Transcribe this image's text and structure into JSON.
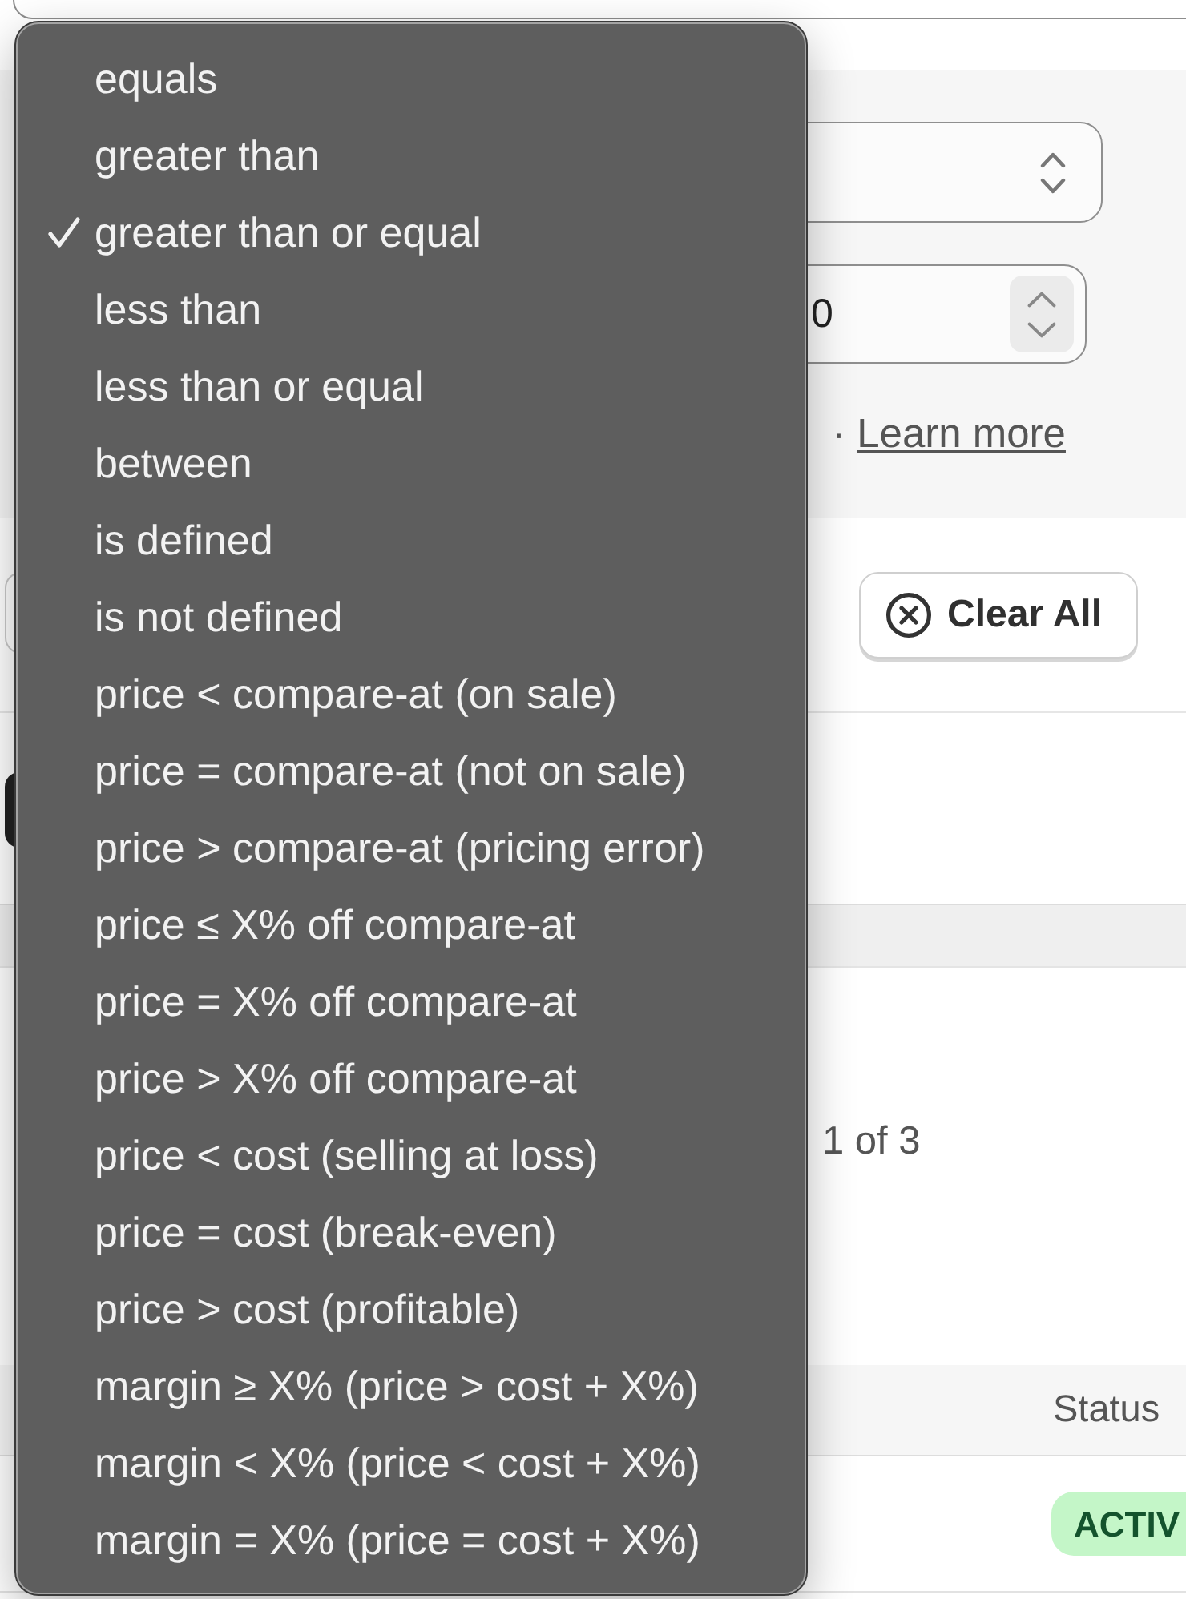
{
  "filter_panel": {
    "value_field": {
      "value": "0"
    },
    "helper_text": "·",
    "learn_more_link": "Learn more"
  },
  "toolbar": {
    "clear_button": "Clear All"
  },
  "results": {
    "pagination": "1 of 3"
  },
  "table": {
    "columns": [
      "Status"
    ],
    "rows": [
      {
        "status": "ACTIV"
      }
    ]
  },
  "dropdown_menu": {
    "items": [
      {
        "label": "equals",
        "selected": false
      },
      {
        "label": "greater than",
        "selected": false
      },
      {
        "label": "greater than or equal",
        "selected": true
      },
      {
        "label": "less than",
        "selected": false
      },
      {
        "label": "less than or equal",
        "selected": false
      },
      {
        "label": "between",
        "selected": false
      },
      {
        "label": "is defined",
        "selected": false
      },
      {
        "label": "is not defined",
        "selected": false
      },
      {
        "label": "price < compare-at (on sale)",
        "selected": false
      },
      {
        "label": "price = compare-at (not on sale)",
        "selected": false
      },
      {
        "label": "price > compare-at (pricing error)",
        "selected": false
      },
      {
        "label": "price ≤ X% off compare-at",
        "selected": false
      },
      {
        "label": "price = X% off compare-at",
        "selected": false
      },
      {
        "label": "price > X% off compare-at",
        "selected": false
      },
      {
        "label": "price < cost (selling at loss)",
        "selected": false
      },
      {
        "label": "price = cost (break-even)",
        "selected": false
      },
      {
        "label": "price > cost (profitable)",
        "selected": false
      },
      {
        "label": "margin ≥ X% (price > cost + X%)",
        "selected": false
      },
      {
        "label": "margin < X% (price < cost + X%)",
        "selected": false
      },
      {
        "label": "margin = X% (price = cost + X%)",
        "selected": false
      }
    ]
  }
}
